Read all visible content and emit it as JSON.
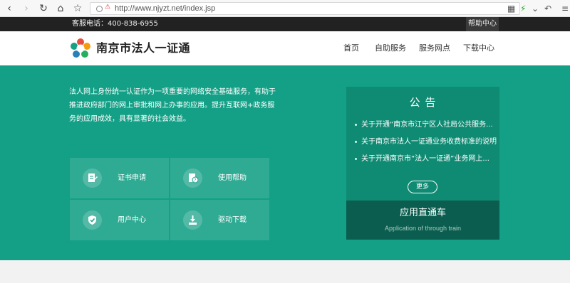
{
  "browser": {
    "url": "http://www.njyzt.net/index.jsp",
    "back_icon": "chevron-left-icon",
    "forward_icon": "chevron-right-icon",
    "reload_icon": "reload-icon",
    "home_icon": "home-icon",
    "star_icon": "star-icon"
  },
  "topbar": {
    "hotline": "客服电话：400-838-6955",
    "help": "帮助中心"
  },
  "header": {
    "site_name": "南京市法人一证通",
    "menu": [
      "首页",
      "自助服务",
      "服务网点",
      "下载中心"
    ]
  },
  "hero": {
    "intro": "法人网上身份统一认证作为一项重要的网络安全基础服务，有助于推进政府部门的网上审批和网上办事的应用。提升互联网+政务服务的应用成效，具有显著的社会效益。",
    "services": [
      {
        "label": "证书申请",
        "icon": "document-edit-icon"
      },
      {
        "label": "使用帮助",
        "icon": "help-document-icon"
      },
      {
        "label": "用户中心",
        "icon": "shield-check-icon"
      },
      {
        "label": "驱动下载",
        "icon": "download-icon"
      }
    ]
  },
  "notice": {
    "title": "公 告",
    "items": [
      "关于开通“南京市江宁区人社局公共服务...",
      "关于南京市法人一证通业务收费标准的说明",
      "关于开通南京市“法人一证通”业务网上..."
    ],
    "more": "更多"
  },
  "express": {
    "title": "应用直通车",
    "subtitle": "Application of through train"
  },
  "colors": {
    "hero_bg": "#13a086",
    "notice_bg": "#0f8a73",
    "express_bg": "#0b5e4f",
    "topbar_bg": "#222222"
  }
}
